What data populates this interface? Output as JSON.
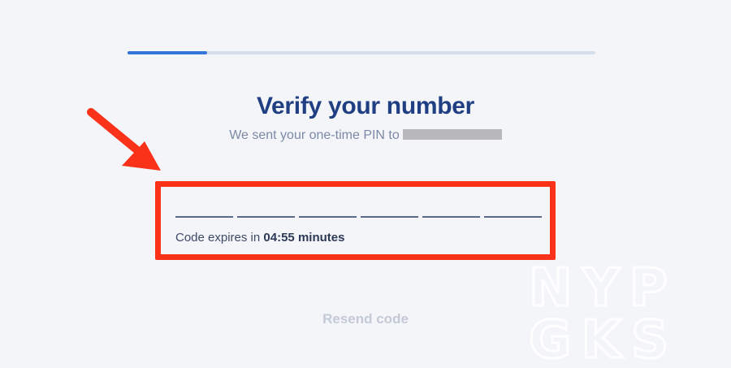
{
  "progress": {
    "fraction": 0.17,
    "fill_color": "#3577d8",
    "track_color": "#d5deeb"
  },
  "header": {
    "title": "Verify your number",
    "subtitle_prefix": "We sent your one-time PIN to"
  },
  "pin": {
    "digits": 6
  },
  "expiry": {
    "prefix": "Code expires in",
    "time": "04:55",
    "suffix": "minutes"
  },
  "actions": {
    "resend_label": "Resend code"
  },
  "watermark": {
    "line1": "NYP",
    "line2": "GKS"
  },
  "colors": {
    "title": "#1f3f82",
    "highlight": "#fa3219",
    "background": "#f3f5f9"
  }
}
